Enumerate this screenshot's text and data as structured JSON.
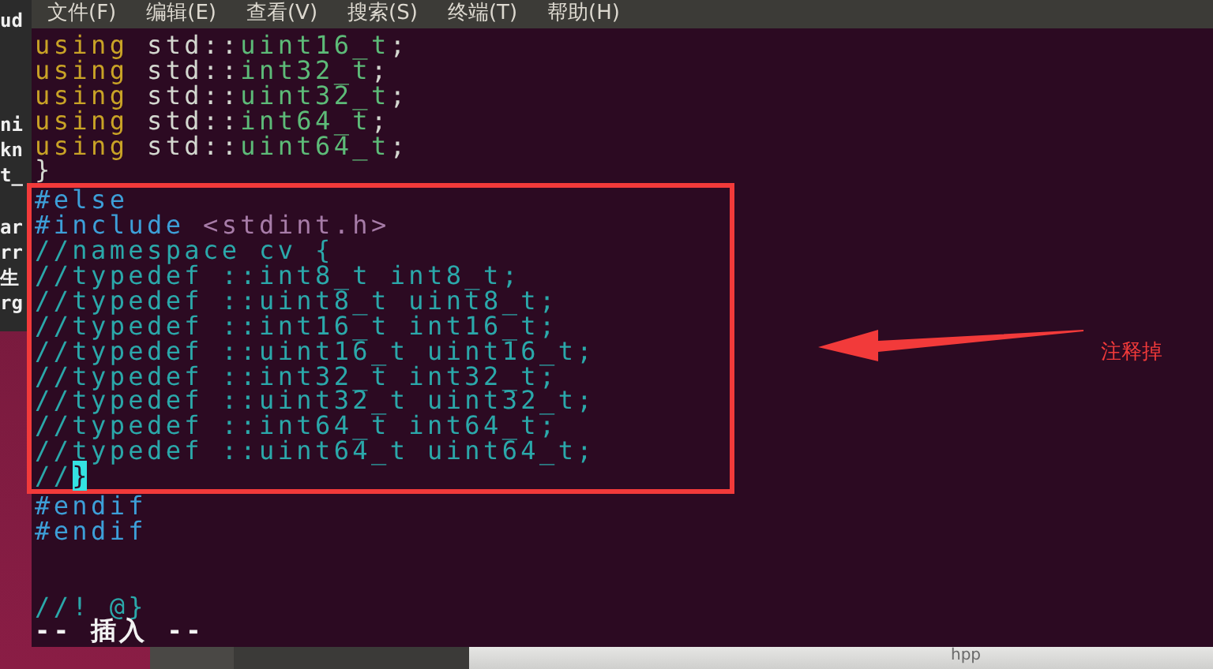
{
  "menu": [
    "文件(F)",
    "编辑(E)",
    "查看(V)",
    "搜索(S)",
    "终端(T)",
    "帮助(H)"
  ],
  "background_window": {
    "fragments": [
      "ud",
      "ni",
      "kn",
      "t_",
      "ar",
      "rr",
      "生",
      "rg"
    ]
  },
  "editor": {
    "blocks": [
      {
        "highlighted": false,
        "lines": [
          {
            "kind": "code",
            "segments": [
              {
                "text": "using",
                "kind": "keyword"
              },
              {
                "text": " std::",
                "kind": "plain"
              },
              {
                "text": "uint16_t",
                "kind": "type"
              },
              {
                "text": ";",
                "kind": "plain"
              }
            ]
          },
          {
            "kind": "code",
            "segments": [
              {
                "text": "using",
                "kind": "keyword"
              },
              {
                "text": " std::",
                "kind": "plain"
              },
              {
                "text": "int32_t",
                "kind": "type"
              },
              {
                "text": ";",
                "kind": "plain"
              }
            ]
          },
          {
            "kind": "code",
            "segments": [
              {
                "text": "using",
                "kind": "keyword"
              },
              {
                "text": " std::",
                "kind": "plain"
              },
              {
                "text": "uint32_t",
                "kind": "type"
              },
              {
                "text": ";",
                "kind": "plain"
              }
            ]
          },
          {
            "kind": "code",
            "segments": [
              {
                "text": "using",
                "kind": "keyword"
              },
              {
                "text": " std::",
                "kind": "plain"
              },
              {
                "text": "int64_t",
                "kind": "type"
              },
              {
                "text": ";",
                "kind": "plain"
              }
            ]
          },
          {
            "kind": "code",
            "segments": [
              {
                "text": "using",
                "kind": "keyword"
              },
              {
                "text": " std::",
                "kind": "plain"
              },
              {
                "text": "uint64_t",
                "kind": "type"
              },
              {
                "text": ";",
                "kind": "plain"
              }
            ]
          },
          {
            "kind": "code",
            "segments": [
              {
                "text": "}",
                "kind": "plain"
              }
            ]
          }
        ]
      },
      {
        "highlighted": true,
        "lines": [
          {
            "kind": "code",
            "segments": [
              {
                "text": "#else",
                "kind": "preproc"
              }
            ]
          },
          {
            "kind": "code",
            "segments": [
              {
                "text": "#include",
                "kind": "preproc"
              },
              {
                "text": " <stdint.h>",
                "kind": "string"
              }
            ]
          },
          {
            "kind": "code",
            "segments": [
              {
                "text": "//namespace cv {",
                "kind": "comment"
              }
            ]
          },
          {
            "kind": "code",
            "segments": [
              {
                "text": "//typedef ::int8_t int8_t;",
                "kind": "comment"
              }
            ]
          },
          {
            "kind": "code",
            "segments": [
              {
                "text": "//typedef ::uint8_t uint8_t;",
                "kind": "comment"
              }
            ]
          },
          {
            "kind": "code",
            "segments": [
              {
                "text": "//typedef ::int16_t int16_t;",
                "kind": "comment"
              }
            ]
          },
          {
            "kind": "code",
            "segments": [
              {
                "text": "//typedef ::uint16_t uint16_t;",
                "kind": "comment"
              }
            ]
          },
          {
            "kind": "code",
            "segments": [
              {
                "text": "//typedef ::int32_t int32_t;",
                "kind": "comment"
              }
            ]
          },
          {
            "kind": "code",
            "segments": [
              {
                "text": "//typedef ::uint32_t uint32_t;",
                "kind": "comment"
              }
            ]
          },
          {
            "kind": "code",
            "segments": [
              {
                "text": "//typedef ::int64_t int64_t;",
                "kind": "comment"
              }
            ]
          },
          {
            "kind": "code",
            "segments": [
              {
                "text": "//typedef ::uint64_t uint64_t;",
                "kind": "comment"
              }
            ]
          },
          {
            "kind": "code",
            "segments": [
              {
                "text": "//",
                "kind": "comment"
              },
              {
                "text": "}",
                "kind": "cursor"
              }
            ]
          }
        ]
      },
      {
        "highlighted": false,
        "lines": [
          {
            "kind": "code",
            "segments": [
              {
                "text": "#endif",
                "kind": "preproc"
              }
            ]
          },
          {
            "kind": "code",
            "segments": [
              {
                "text": "#endif",
                "kind": "preproc"
              }
            ]
          },
          {
            "kind": "blank"
          },
          {
            "kind": "blank"
          },
          {
            "kind": "code",
            "segments": [
              {
                "text": "//! @}",
                "kind": "comment"
              }
            ]
          }
        ]
      }
    ],
    "mode": "-- 插入 --"
  },
  "annotation": {
    "label": "注释掉"
  },
  "taskbar": {
    "label": "hpp"
  }
}
